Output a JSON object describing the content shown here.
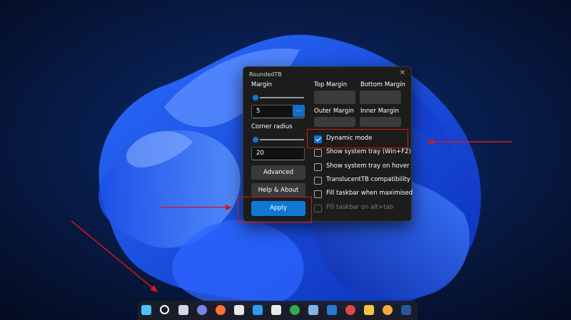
{
  "window": {
    "title": "RoundedTB",
    "close_glyph": "✕"
  },
  "left": {
    "margin_label": "Margin",
    "margin_value": "5",
    "more_glyph": "...",
    "corner_label": "Corner radius",
    "corner_value": "20",
    "advanced_label": "Advanced",
    "help_label": "Help & About",
    "apply_label": "Apply"
  },
  "right": {
    "top_margin": "Top Margin",
    "bottom_margin": "Bottom Margin",
    "outer_margin": "Outer Margin",
    "inner_margin": "Inner Margin"
  },
  "options": [
    {
      "label": "Dynamic mode",
      "checked": true,
      "enabled": true
    },
    {
      "label": "Show system tray (Win+F2)",
      "checked": false,
      "enabled": true
    },
    {
      "label": "Show system tray on hover",
      "checked": false,
      "enabled": true
    },
    {
      "label": "TranslucentTB compatibility",
      "checked": false,
      "enabled": true
    },
    {
      "label": "Fill taskbar when maximised",
      "checked": false,
      "enabled": true
    },
    {
      "label": "Fill taskbar on alt+tab",
      "checked": false,
      "enabled": false
    }
  ],
  "colors": {
    "accent": "#0f78d4",
    "highlight": "#d11a1a",
    "window_bg": "#1c1c1c"
  },
  "taskbar_icons": [
    {
      "name": "start-icon",
      "color": "#4cc2ff"
    },
    {
      "name": "search-icon",
      "color": "#ffffff"
    },
    {
      "name": "task-view-icon",
      "color": "#cfd8e8"
    },
    {
      "name": "chat-icon",
      "color": "#7b83eb"
    },
    {
      "name": "firefox-icon",
      "color": "#ff7139"
    },
    {
      "name": "snipping-tool-icon",
      "color": "#e8e8e8"
    },
    {
      "name": "onedrive-icon",
      "color": "#2f9bf0"
    },
    {
      "name": "roundedtb-icon",
      "color": "#e8e8e8"
    },
    {
      "name": "chrome-icon",
      "color": "#34a853"
    },
    {
      "name": "notepad-icon",
      "color": "#7fb6ea"
    },
    {
      "name": "mail-icon",
      "color": "#2a78d6"
    },
    {
      "name": "wheel-icon",
      "color": "#e04848"
    },
    {
      "name": "file-explorer-icon",
      "color": "#f4c542"
    },
    {
      "name": "chrome-canary-icon",
      "color": "#f2a93b"
    },
    {
      "name": "word-icon",
      "color": "#2b5797"
    }
  ]
}
